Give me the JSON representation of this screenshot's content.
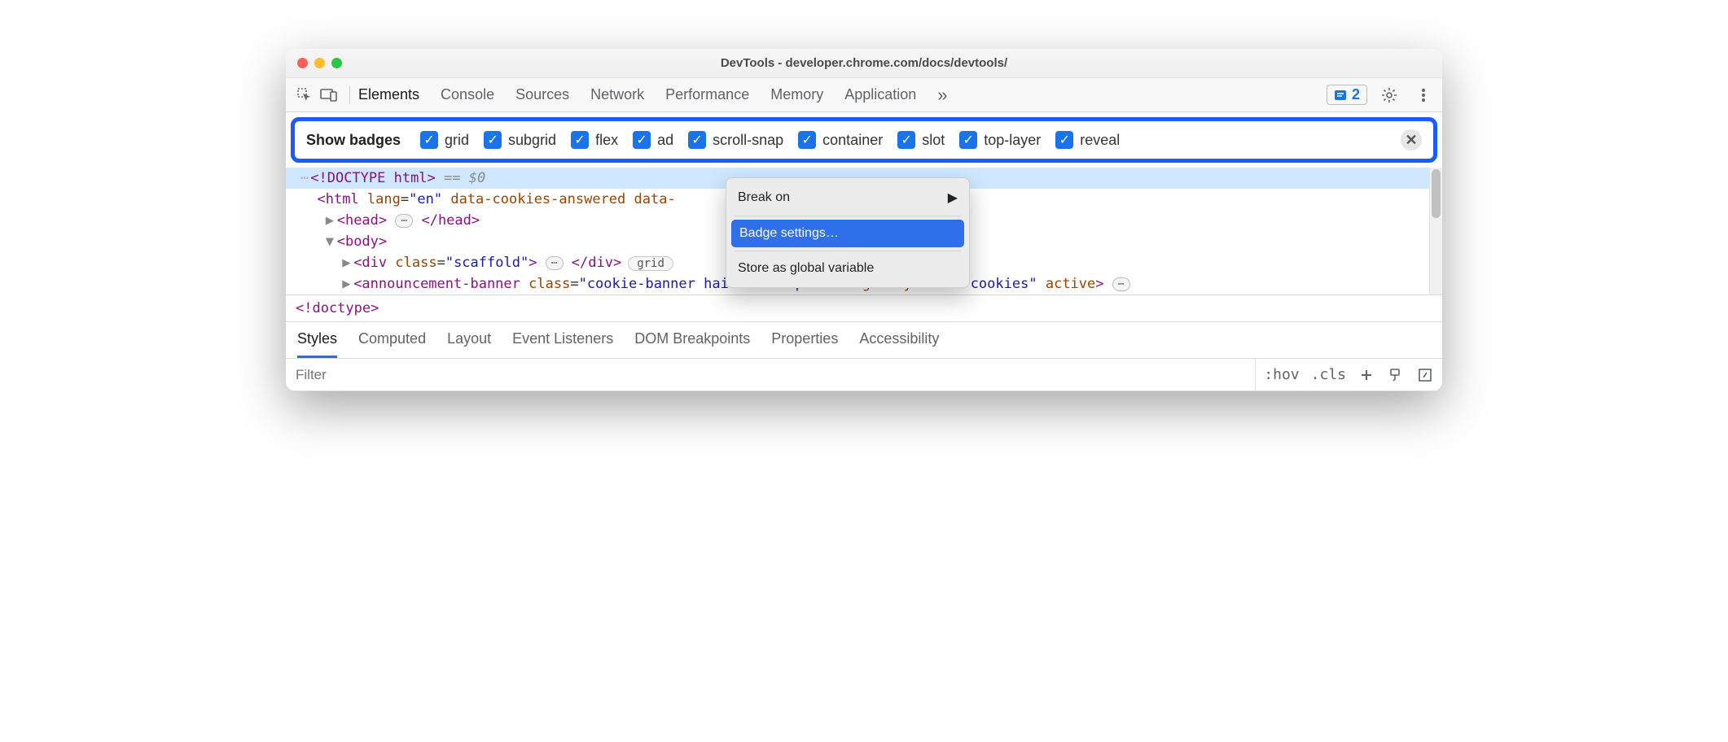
{
  "window": {
    "title": "DevTools - developer.chrome.com/docs/devtools/"
  },
  "toolbar": {
    "tabs": [
      "Elements",
      "Console",
      "Sources",
      "Network",
      "Performance",
      "Memory",
      "Application"
    ],
    "activeTab": "Elements",
    "issues_count": "2"
  },
  "badge_bar": {
    "label": "Show badges",
    "items": [
      "grid",
      "subgrid",
      "flex",
      "ad",
      "scroll-snap",
      "container",
      "slot",
      "top-layer",
      "reveal"
    ]
  },
  "dom": {
    "selected_suffix": "== $0",
    "doctype": "<!DOCTYPE html>",
    "html_open_prefix": "<html ",
    "html_attr1_name": "lang",
    "html_attr1_value": "en",
    "html_attr2_name": "data-cookies-answered",
    "html_attr3_prefix": "data-",
    "head_open": "<head>",
    "head_close": "</head>",
    "body_open": "<body>",
    "div_open": "<div ",
    "div_class_name": "class",
    "div_class_value": "scaffold",
    "div_close": "</div>",
    "grid_badge": "grid",
    "ab_open": "<announcement-banner ",
    "ab_class_name": "class",
    "ab_class_value": "cookie-banner hairline-top",
    "ab_storage_name": "storage-key",
    "ab_storage_value": "user-cookies",
    "ab_active": "active",
    "ab_gt": ">",
    "breadcrumb": "<!doctype>"
  },
  "context_menu": {
    "item1": "Break on",
    "item2": "Badge settings…",
    "item3": "Store as global variable"
  },
  "sub_tabs": [
    "Styles",
    "Computed",
    "Layout",
    "Event Listeners",
    "DOM Breakpoints",
    "Properties",
    "Accessibility"
  ],
  "sub_tab_active": "Styles",
  "styles_bar": {
    "filter_placeholder": "Filter",
    "hov": ":hov",
    "cls": ".cls"
  }
}
